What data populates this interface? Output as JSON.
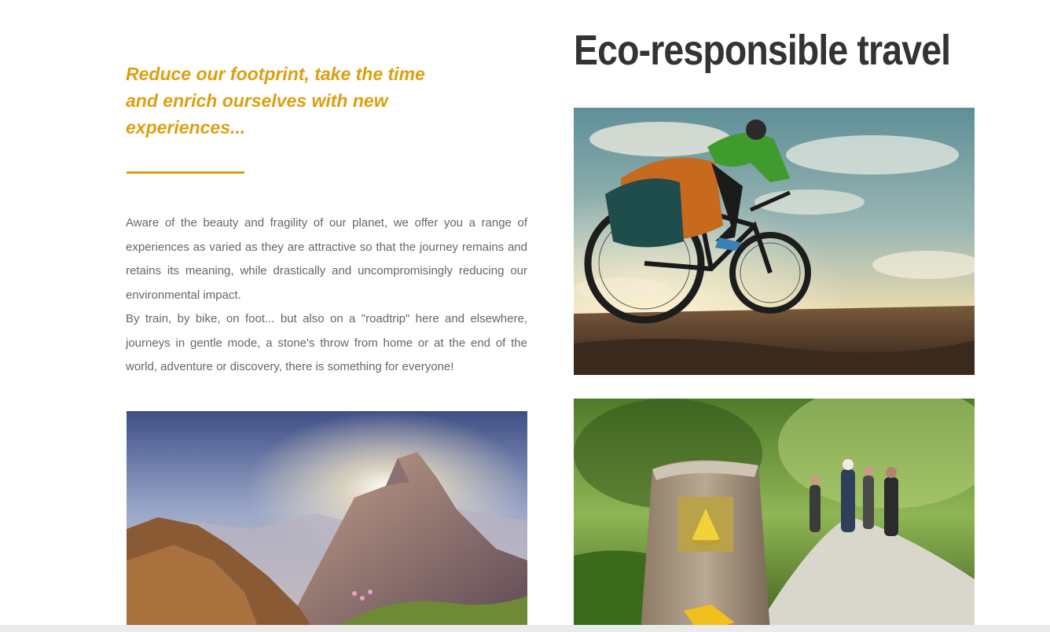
{
  "heading": {
    "title": "Eco-responsible travel"
  },
  "tagline": {
    "line1": "Reduce our footprint, take the time",
    "line2": "and enrich ourselves with new",
    "line3": "experiences..."
  },
  "intro": {
    "paragraph1": "Aware of the beauty and fragility of our planet, we offer you a range of experiences as varied as they are attractive so that the journey remains and retains its meaning, while drastically and uncompromisingly reducing our environmental impact.",
    "paragraph2": "By train, by bike, on foot... but also on a \"roadtrip\" here and elsewhere, journeys in gentle mode, a stone's throw from home or at the end of the world, adventure or discovery, there is something for everyone!"
  },
  "colors": {
    "accent": "#dd9f0f",
    "title_text": "#333333",
    "body_text": "#666666"
  },
  "images": [
    {
      "name": "cyclist-photo"
    },
    {
      "name": "mountain-sunrise-photo"
    },
    {
      "name": "hiking-trail-marker-photo"
    }
  ]
}
